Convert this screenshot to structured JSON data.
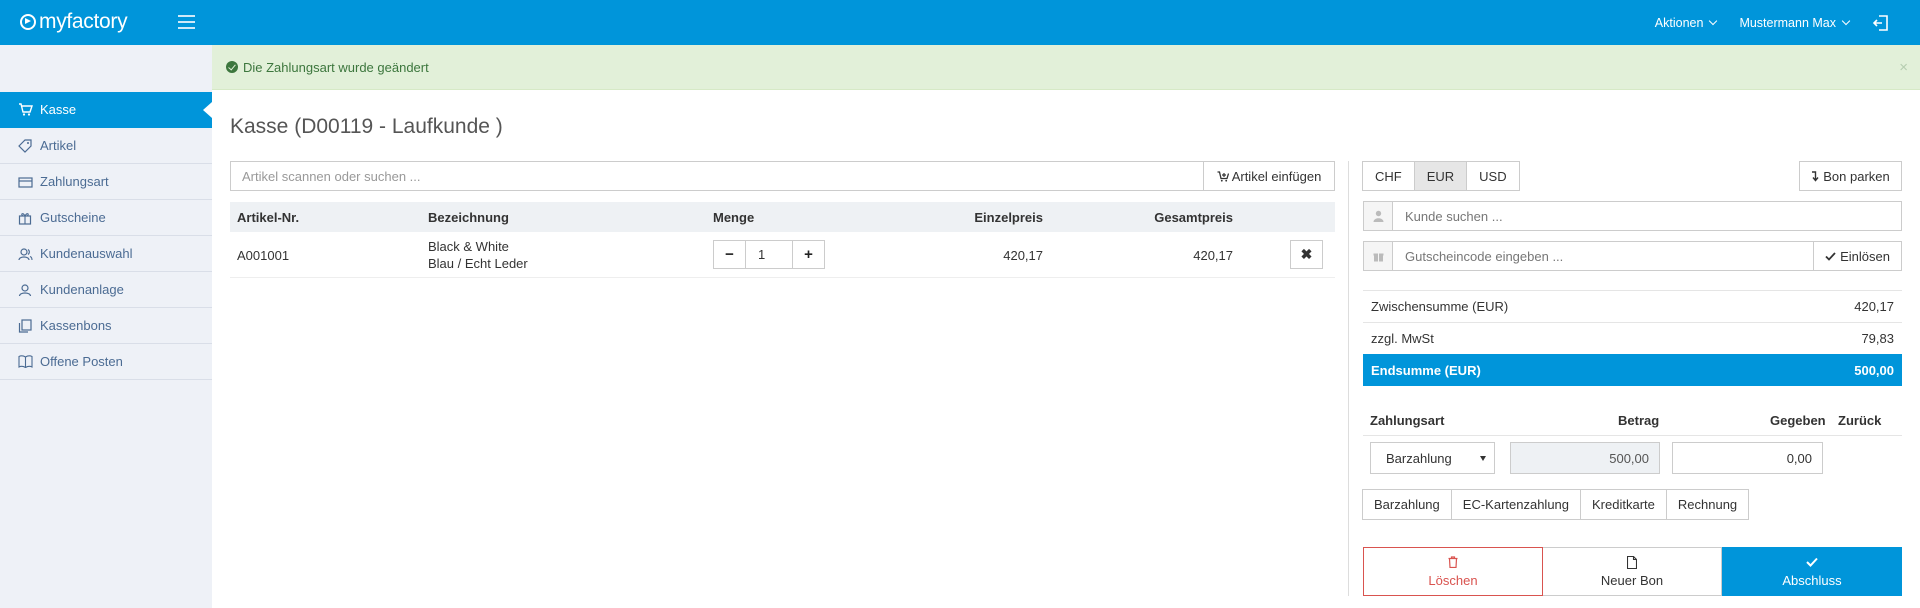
{
  "header": {
    "logo": "myfactory",
    "actions_label": "Aktionen",
    "user_label": "Mustermann Max"
  },
  "sidebar": {
    "items": [
      {
        "label": "Kasse",
        "icon": "cart-icon"
      },
      {
        "label": "Artikel",
        "icon": "tag-icon"
      },
      {
        "label": "Zahlungsart",
        "icon": "card-icon"
      },
      {
        "label": "Gutscheine",
        "icon": "gift-icon"
      },
      {
        "label": "Kundenauswahl",
        "icon": "users-icon"
      },
      {
        "label": "Kundenanlage",
        "icon": "user-icon"
      },
      {
        "label": "Kassenbons",
        "icon": "receipts-icon"
      },
      {
        "label": "Offene Posten",
        "icon": "book-icon"
      }
    ]
  },
  "alert": {
    "message": "Die Zahlungsart wurde geändert",
    "close": "×"
  },
  "main": {
    "title": "Kasse (D00119 - Laufkunde )",
    "search_placeholder": "Artikel scannen oder suchen ...",
    "insert_label": "Artikel einfügen"
  },
  "table": {
    "headers": [
      "Artikel-Nr.",
      "Bezeichnung",
      "Menge",
      "Einzelpreis",
      "Gesamtpreis"
    ],
    "rows": [
      {
        "article_no": "A001001",
        "name_line1": "Black & White",
        "name_line2": "Blau / Echt Leder",
        "qty": "1",
        "unit_price": "420,17",
        "total": "420,17"
      }
    ]
  },
  "panel": {
    "currencies": [
      "CHF",
      "EUR",
      "USD"
    ],
    "active_currency": "EUR",
    "park_label": "Bon parken",
    "customer_placeholder": "Kunde suchen ...",
    "voucher_placeholder": "Gutscheincode eingeben ...",
    "redeem_label": "Einlösen",
    "subtotal_label": "Zwischensumme (EUR)",
    "subtotal_value": "420,17",
    "tax_label": "zzgl. MwSt",
    "tax_value": "79,83",
    "total_label": "Endsumme (EUR)",
    "total_value": "500,00",
    "pay_headers": [
      "Zahlungsart",
      "Betrag",
      "Gegeben",
      "Zurück"
    ],
    "pay_method": "Barzahlung",
    "amount": "500,00",
    "given": "0,00",
    "pay_buttons": [
      "Barzahlung",
      "EC-Kartenzahlung",
      "Kreditkarte",
      "Rechnung"
    ],
    "delete_label": "Löschen",
    "new_label": "Neuer Bon",
    "finish_label": "Abschluss"
  },
  "colors": {
    "brand": "#0095da",
    "success_bg": "#e2f0d9",
    "danger": "#d9534f"
  }
}
